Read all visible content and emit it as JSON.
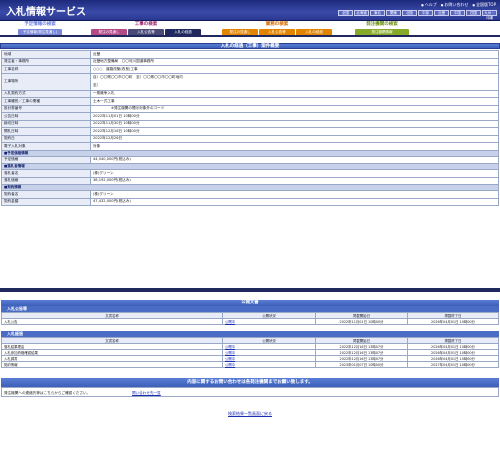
{
  "header": {
    "title": "入札情報サービス",
    "links": [
      "ヘルプ",
      "お問い合わせ",
      "全国版TOP"
    ],
    "regions": [
      "全国",
      "北海道",
      "東北",
      "関東",
      "北陸",
      "中部",
      "近畿",
      "中国",
      "四国",
      "九州・沖縄"
    ]
  },
  "nav": {
    "groups": [
      {
        "title": "予定情報の検索",
        "color": "#6c7ee0",
        "tabs": [
          {
            "label": "予定情報(発注見通し)",
            "color": "#7b88d9"
          }
        ]
      },
      {
        "title": "工事の検索",
        "color": "#9b2a6e",
        "tabs": [
          {
            "label": "発注の見通し",
            "color": "#b14a86"
          },
          {
            "label": "入札公告等",
            "color": "#4a4a78"
          },
          {
            "label": "入札の経過",
            "color": "#21285e"
          }
        ]
      },
      {
        "title": "業務の検索",
        "color": "#d06a00",
        "tabs": [
          {
            "label": "発注の見通し",
            "color": "#e38400"
          },
          {
            "label": "入札公告等",
            "color": "#e38400"
          },
          {
            "label": "入札の経過",
            "color": "#e38400"
          }
        ]
      },
      {
        "title": "発注機関の検索",
        "color": "#6b8f14",
        "tabs": [
          {
            "label": "発注機関情報",
            "color": "#86a928"
          }
        ]
      }
    ]
  },
  "page_title": "入札の経過（工事）案件概要",
  "info_rows": [
    {
      "k": "地域",
      "v": "近畿"
    },
    {
      "k": "発注者・事務所",
      "v": "近畿地方整備局　〇〇河川国道事務所"
    },
    {
      "k": "工事名称",
      "v": "○○○　道路改築(改良)工事"
    },
    {
      "k": "工事場所",
      "v": "自）〇〇県〇〇市〇〇町　至）〇〇県〇〇市〇〇町地内",
      "v2": "至）"
    },
    {
      "k": "入札契約方式",
      "v": "一般競争入札"
    },
    {
      "k": "工事種別／工事の業種",
      "v": "土木一式工事"
    },
    {
      "k": "設計書番号",
      "v": "※発注機関の開示対象外のコード"
    },
    {
      "k": "公告日時",
      "v": "2022年11月01日 10時00分"
    },
    {
      "k": "締切日時",
      "v": "2022年11月30日 10時00分"
    },
    {
      "k": "開札日時",
      "v": "2022年12月16日 10時00分"
    },
    {
      "k": "契約日",
      "v": "2022年12月26日"
    },
    {
      "k": "電子入札対象",
      "v": "対象"
    }
  ],
  "estimate": {
    "section": "■予定価格情報",
    "k": "予定価格",
    "v": "44,540,000円(税込み)"
  },
  "winner": {
    "section": "■落札者情報",
    "name_k": "落札者名",
    "name_v": "(株)グリーン",
    "price_k": "落札価格",
    "price_v": "38,192,000円(税込み)"
  },
  "contract": {
    "section": "■契約情報",
    "name_k": "契約者名",
    "name_v": "(株)グリーン",
    "price_k": "契約金額",
    "price_v": "47,432,000円(税込み)"
  },
  "docs": {
    "title": "公開文書",
    "s1": {
      "title": "入札公告等",
      "cols": [
        "文書名称",
        "公開状況",
        "掲載開始日",
        "掲載終了日"
      ],
      "rows": [
        [
          "入札公告",
          "公開中",
          "2022年11月01日 10時00分",
          "2026年04月01日 10時00分"
        ]
      ]
    },
    "s2": {
      "title": "入札経過",
      "cols": [
        "文書名称",
        "公開状況",
        "掲載開始日",
        "掲載終了日"
      ],
      "rows": [
        [
          "落札結果理由",
          "公開中",
          "2022年12月16日 13時07分",
          "2026年04月01日 10時00分"
        ],
        [
          "入札参加資格確認結果",
          "公開中",
          "2022年12月16日 13時07分",
          "2026年04月01日 10時00分"
        ],
        [
          "入札調書",
          "公開中",
          "2022年12月16日 13時07分",
          "2026年04月01日 10時00分"
        ],
        [
          "契約情報",
          "公開中",
          "2023年01月07日 10時00分",
          "2027年04月01日 10時00分"
        ]
      ]
    }
  },
  "contact": {
    "title": "内容に関するお問い合わせは各発注機関までお願い致します。",
    "label": "発注機関への連絡先等はこちらからご確認ください。",
    "link": "問い合わせ先一覧"
  },
  "back": "検索結果一覧画面に戻る"
}
